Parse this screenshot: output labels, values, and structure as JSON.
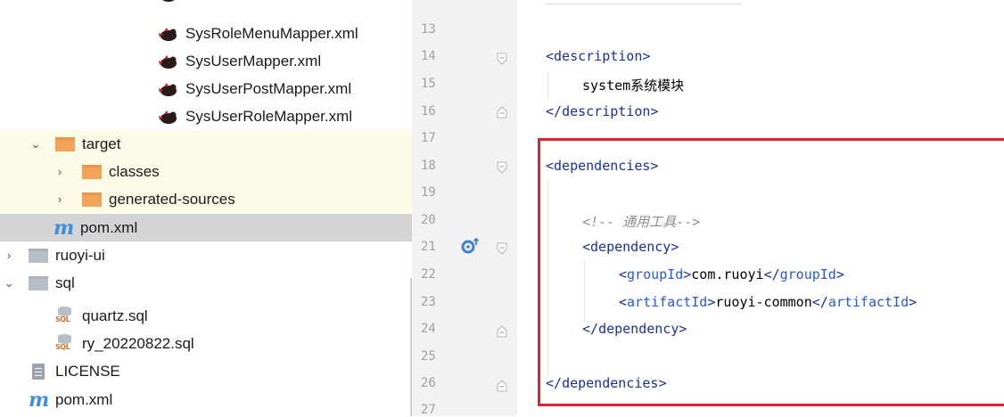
{
  "tree": {
    "items": [
      {
        "label": "SysRoleMenuMapper.xml"
      },
      {
        "label": "SysUserMapper.xml"
      },
      {
        "label": "SysUserPostMapper.xml"
      },
      {
        "label": "SysUserRoleMapper.xml"
      },
      {
        "label": "target"
      },
      {
        "label": "classes"
      },
      {
        "label": "generated-sources"
      },
      {
        "label": "pom.xml"
      },
      {
        "label": "ruoyi-ui"
      },
      {
        "label": "sql"
      },
      {
        "label": "quartz.sql"
      },
      {
        "label": "ry_20220822.sql"
      },
      {
        "label": "LICENSE"
      },
      {
        "label": "pom.xml"
      }
    ],
    "icons": {
      "maven": "m",
      "sql_badge": "SQL"
    }
  },
  "editor": {
    "line_numbers": [
      "13",
      "14",
      "15",
      "16",
      "17",
      "18",
      "19",
      "20",
      "21",
      "22",
      "23",
      "24",
      "25",
      "26",
      "27"
    ],
    "lines": {
      "l14_tag": "description",
      "l15_text": "system系统模块",
      "l16_tag": "description",
      "l18_tag": "dependencies",
      "l20_comment": "<!-- 通用工具-->",
      "l21_tag": "dependency",
      "l22_tag": "groupId",
      "l22_value": "com.ruoyi",
      "l23_tag": "artifactId",
      "l23_value": "ruoyi-common",
      "l24_tag": "dependency",
      "l26_tag": "dependencies"
    }
  },
  "colors": {
    "highlight_box": "#e0232f",
    "excluded_folder_bg": "#fbfbe7",
    "selected_row_bg": "#d4d4d4",
    "xml_tag": "#1a2fa0"
  }
}
